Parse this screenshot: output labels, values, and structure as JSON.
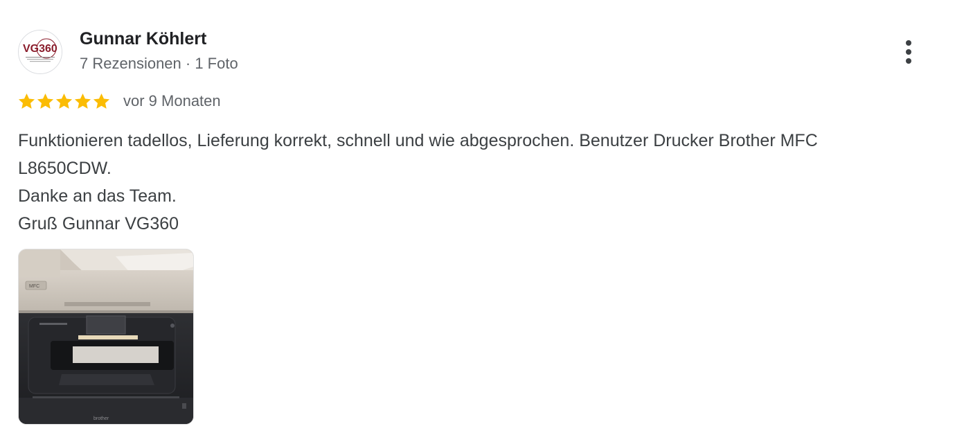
{
  "reviewer": {
    "name": "Gunnar Köhlert",
    "meta": "7 Rezensionen · 1 Foto",
    "avatar_logo_text": "VG360",
    "avatar_icon": "vg360-logo-avatar"
  },
  "rating": {
    "stars": 5,
    "max": 5,
    "star_color": "#fbbc04",
    "date": "vor 9 Monaten"
  },
  "review": {
    "lines": [
      "Funktionieren tadellos, Lieferung korrekt, schnell und wie abgesprochen. Benutzer Drucker Brother MFC",
      "L8650CDW.",
      "Danke an das Team.",
      "Gruß Gunnar VG360"
    ]
  },
  "photo": {
    "icon": "printer-photo",
    "printer_brand_text": "brother",
    "printer_badge_text": "MFC"
  },
  "menu": {
    "icon": "more-vert-icon"
  }
}
